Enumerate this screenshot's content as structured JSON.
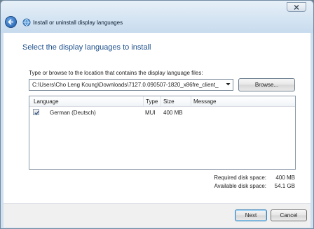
{
  "window": {
    "title": "Install or uninstall display languages"
  },
  "page": {
    "heading": "Select the display languages to install"
  },
  "path": {
    "label": "Type or browse to the location that contains the display language files:",
    "value": "C:\\Users\\Cho Leng Koung\\Downloads\\7127.0.090507-1820_x86fre_client_",
    "browse_label": "Browse..."
  },
  "list": {
    "columns": [
      "Language",
      "Type",
      "Size",
      "Message"
    ],
    "rows": [
      {
        "checked": true,
        "language": "German (Deutsch)",
        "type": "MUI",
        "size": "400 MB",
        "message": ""
      }
    ]
  },
  "disk": {
    "required_label": "Required disk space:",
    "required_value": "400 MB",
    "available_label": "Available disk space:",
    "available_value": "54.1 GB"
  },
  "buttons": {
    "next": "Next",
    "cancel": "Cancel"
  },
  "colors": {
    "heading": "#1c4f8c",
    "window_frame": "#cfe0ef",
    "default_button_border": "#3c7fb1"
  }
}
